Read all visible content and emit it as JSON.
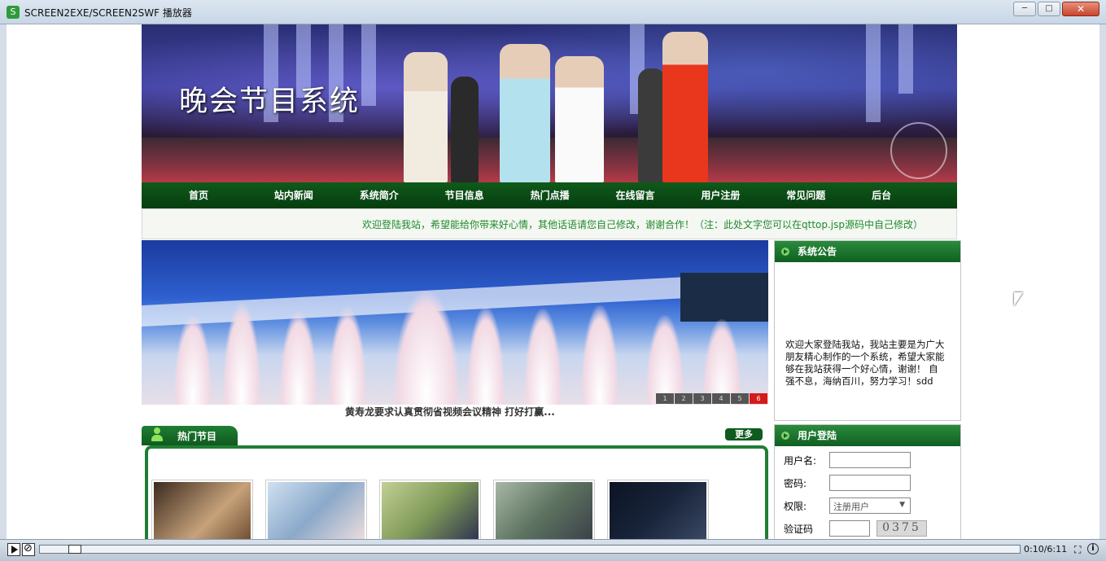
{
  "window": {
    "title": "SCREEN2EXE/SCREEN2SWF 播放器",
    "min_label": "─",
    "max_label": "□",
    "close_label": "✕"
  },
  "banner": {
    "title": "晚会节目系统"
  },
  "nav": {
    "items": [
      {
        "label": "首页"
      },
      {
        "label": "站内新闻"
      },
      {
        "label": "系统简介"
      },
      {
        "label": "节目信息"
      },
      {
        "label": "热门点播"
      },
      {
        "label": "在线留言"
      },
      {
        "label": "用户注册"
      },
      {
        "label": "常见问题"
      },
      {
        "label": "后台"
      }
    ]
  },
  "welcome": "欢迎登陆我站，希望能给你带来好心情，其他话语请您自己修改，谢谢合作！（注：此处文字您可以在qttop.jsp源码中自己修改）",
  "slideshow": {
    "pages": [
      "1",
      "2",
      "3",
      "4",
      "5",
      "6"
    ],
    "active_page": "6",
    "caption": "黄寿龙要求认真贯彻省视频会议精神 打好打赢..."
  },
  "hot": {
    "title": "热门节目",
    "more_label": "更多",
    "thumbnails": [
      {
        "name": "thumb-1",
        "color": "#6b4a2e"
      },
      {
        "name": "thumb-2",
        "color": "#8aa9c9"
      },
      {
        "name": "thumb-3",
        "color": "#7f9a58"
      },
      {
        "name": "thumb-4",
        "color": "#5d7360"
      },
      {
        "name": "thumb-5",
        "color": "#18243a"
      }
    ]
  },
  "announcement": {
    "title": "系统公告",
    "text": "欢迎大家登陆我站，我站主要是为广大朋友精心制作的一个系统，希望大家能够在我站获得一个好心情，谢谢！ 自强不息，海纳百川，努力学习！sdd"
  },
  "login": {
    "title": "用户登陆",
    "username_label": "用户名:",
    "password_label": "密码:",
    "role_label": "权限:",
    "role_value": "注册用户",
    "captcha_label": "验证码",
    "captcha_code": "0375"
  },
  "player": {
    "time": "0:10/6:11",
    "progress": 0.03
  },
  "colors": {
    "nav_green": "#0a4a15",
    "accent_green": "#1f7e34",
    "notice_text": "#1f8a2c",
    "active_page": "#d51a1a"
  }
}
